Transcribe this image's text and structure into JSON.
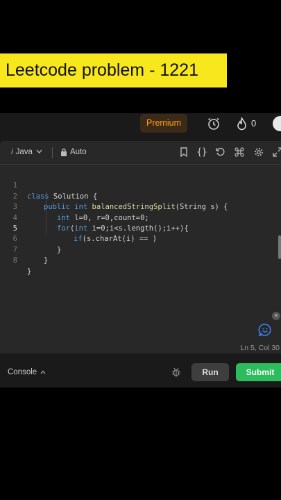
{
  "banner": {
    "title": "Leetcode problem - 1221"
  },
  "topbar": {
    "premium_label": "Premium",
    "fire_count": "0"
  },
  "editor": {
    "language": "Java",
    "info_glyph": "i",
    "mode_label": "Auto",
    "lines": [
      {
        "num": "1"
      },
      {
        "num": "2"
      },
      {
        "num": "3"
      },
      {
        "num": "4"
      },
      {
        "num": "5"
      },
      {
        "num": "6"
      },
      {
        "num": "7"
      },
      {
        "num": "8"
      }
    ],
    "code": {
      "l1_kw": "class",
      "l1_rest": " Solution {",
      "l2_kw": "public",
      "l2_type": " int ",
      "l2_fn": "balancedStringSplit",
      "l2_rest": "(String s) {",
      "l3_kw": "int",
      "l3_rest": " l=0, r=0,count=0;",
      "l4_kw": "for",
      "l4_mid": "(",
      "l4_kw2": "int",
      "l4_rest": " i=0;i<s.length();i++){",
      "l5_kw": "if",
      "l5_rest": "(s.charAt(i) == )",
      "l6": "}",
      "l7": "}",
      "l8": "}"
    },
    "cursor_position": "Ln 5, Col 30"
  },
  "console": {
    "label": "Console",
    "run_label": "Run",
    "submit_label": "Submit"
  },
  "colors": {
    "accent": "#ffa116",
    "submit": "#2cbb5d",
    "banner": "#f8e71c"
  }
}
